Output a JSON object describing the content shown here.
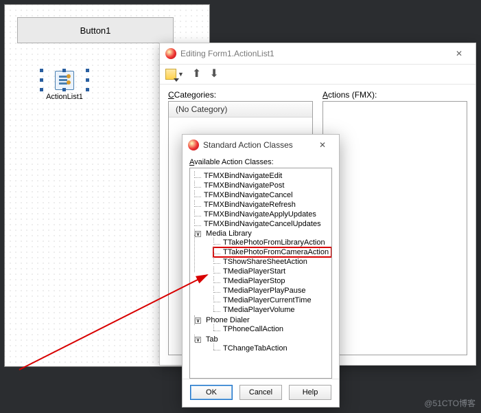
{
  "designer": {
    "button_label": "Button1",
    "component_label": "ActionList1"
  },
  "editing_window": {
    "title": "Editing Form1.ActionList1",
    "categories_label": "Categories:",
    "categories_underline": "C",
    "actions_label": "ctions (FMX):",
    "actions_underline": "A",
    "no_category": "(No Category)"
  },
  "classes_dialog": {
    "title": "Standard Action Classes",
    "available_label": "vailable Action Classes:",
    "available_underline": "A",
    "leading_leaves": [
      "TFMXBindNavigateEdit",
      "TFMXBindNavigatePost",
      "TFMXBindNavigateCancel",
      "TFMXBindNavigateRefresh",
      "TFMXBindNavigateApplyUpdates",
      "TFMXBindNavigateCancelUpdates"
    ],
    "media_group": "Media Library",
    "media_leaves": [
      {
        "name": "TTakePhotoFromLibraryAction",
        "highlight": false
      },
      {
        "name": "TTakePhotoFromCameraAction",
        "highlight": true
      },
      {
        "name": "TShowShareSheetAction",
        "highlight": false
      },
      {
        "name": "TMediaPlayerStart",
        "highlight": false
      },
      {
        "name": "TMediaPlayerStop",
        "highlight": false
      },
      {
        "name": "TMediaPlayerPlayPause",
        "highlight": false
      },
      {
        "name": "TMediaPlayerCurrentTime",
        "highlight": false
      },
      {
        "name": "TMediaPlayerVolume",
        "highlight": false
      }
    ],
    "phone_group": "Phone Dialer",
    "phone_leaves": [
      "TPhoneCallAction"
    ],
    "tab_group": "Tab",
    "tab_leaves": [
      "TChangeTabAction"
    ],
    "buttons": {
      "ok": "OK",
      "cancel": "Cancel",
      "help": "Help"
    }
  },
  "watermark": "@51CTO博客"
}
